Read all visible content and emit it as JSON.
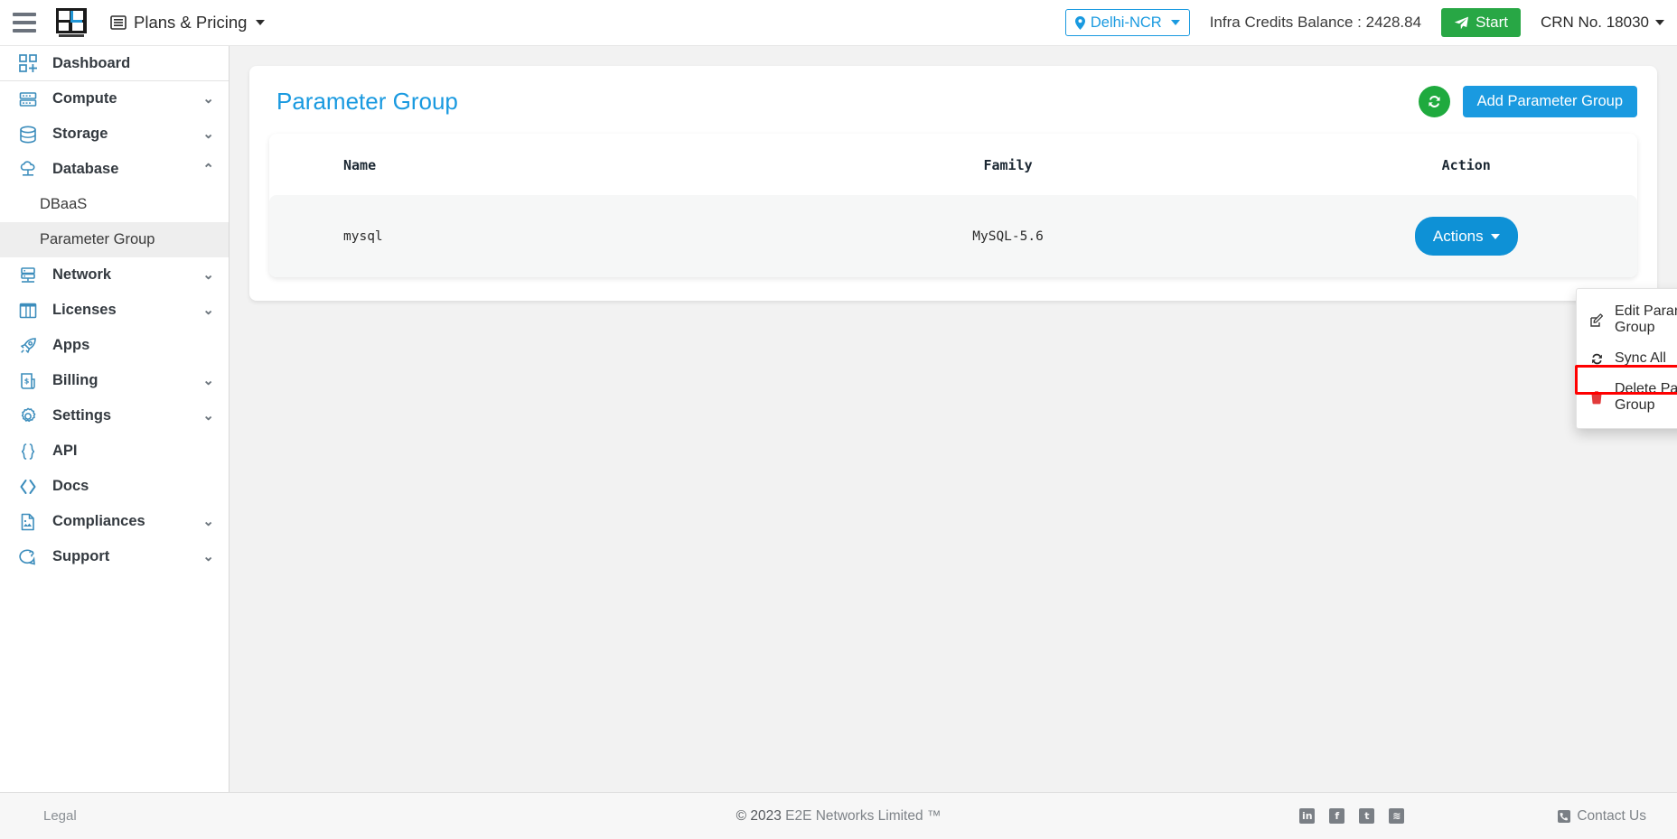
{
  "topbar": {
    "menu_icon": "hamburger-icon",
    "logo_alt": "E2E Networks",
    "plans_label": "Plans & Pricing",
    "region_label": "Delhi-NCR",
    "credits_label": "Infra Credits Balance : 2428.84",
    "start_label": "Start",
    "crn_label": "CRN No. 18030"
  },
  "sidebar": {
    "items": [
      {
        "label": "Dashboard",
        "icon": "dashboard-icon",
        "chevron": ""
      },
      {
        "label": "Compute",
        "icon": "server-icon",
        "chevron": "⌄"
      },
      {
        "label": "Storage",
        "icon": "database-icon",
        "chevron": "⌄"
      },
      {
        "label": "Database",
        "icon": "cloud-db-icon",
        "chevron": "⌃"
      },
      {
        "label": "Network",
        "icon": "network-icon",
        "chevron": "⌄"
      },
      {
        "label": "Licenses",
        "icon": "licenses-icon",
        "chevron": "⌄"
      },
      {
        "label": "Apps",
        "icon": "rocket-icon",
        "chevron": ""
      },
      {
        "label": "Billing",
        "icon": "billing-icon",
        "chevron": "⌄"
      },
      {
        "label": "Settings",
        "icon": "gear-icon",
        "chevron": "⌄"
      },
      {
        "label": "API",
        "icon": "braces-icon",
        "chevron": ""
      },
      {
        "label": "Docs",
        "icon": "code-icon",
        "chevron": ""
      },
      {
        "label": "Compliances",
        "icon": "document-icon",
        "chevron": "⌄"
      },
      {
        "label": "Support",
        "icon": "support-icon",
        "chevron": "⌄"
      }
    ],
    "database_children": [
      {
        "label": "DBaaS",
        "active": false
      },
      {
        "label": "Parameter Group",
        "active": true
      }
    ]
  },
  "main": {
    "page_title": "Parameter Group",
    "refresh_icon": "refresh-icon",
    "add_button_label": "Add Parameter Group",
    "table": {
      "columns": [
        "Name",
        "Family",
        "Action"
      ],
      "rows": [
        {
          "name": "mysql",
          "family": "MySQL-5.6",
          "action_label": "Actions"
        }
      ]
    },
    "dropdown": {
      "open": true,
      "items": [
        {
          "label": "Edit Parameter Group",
          "icon": "edit-icon",
          "danger": false
        },
        {
          "label": "Sync All",
          "icon": "sync-icon",
          "danger": false
        },
        {
          "label": "Delete Parameter Group",
          "icon": "trash-icon",
          "danger": true
        }
      ],
      "highlighted_index": 2
    }
  },
  "footer": {
    "legal_label": "Legal",
    "copyright_symbol": "©",
    "copyright_year": "2023",
    "copyright_text": "E2E Networks Limited ™",
    "social": [
      {
        "name": "linkedin-icon",
        "glyph": "in"
      },
      {
        "name": "facebook-icon",
        "glyph": "f"
      },
      {
        "name": "twitter-icon",
        "glyph": "t"
      },
      {
        "name": "rss-icon",
        "glyph": "≋"
      }
    ],
    "contact_label": "Contact Us"
  },
  "colors": {
    "accent_blue": "#1a9ae0",
    "action_blue": "#0e91d6",
    "green": "#28a745",
    "refresh_green": "#1faa3e",
    "danger_red": "#e23b3b",
    "highlight_red": "#ff0000",
    "sidebar_icon": "#3c8dbc"
  }
}
